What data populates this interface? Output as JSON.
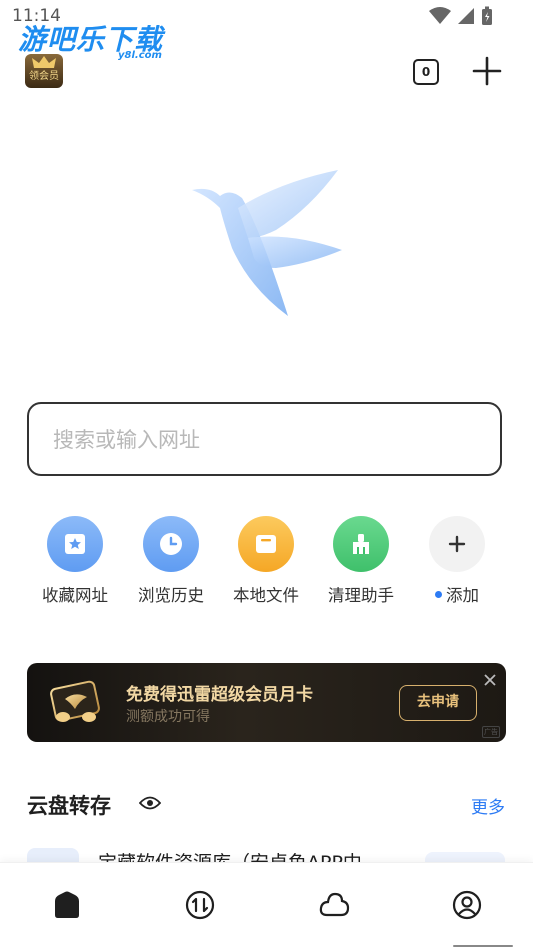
{
  "status_bar": {
    "time": "11:14"
  },
  "watermark": {
    "text": "游吧乐下载",
    "sub": "y8l.com"
  },
  "header": {
    "vip_badge_label": "领会员",
    "tab_count": "0"
  },
  "search": {
    "placeholder": "搜索或输入网址"
  },
  "shortcuts": [
    {
      "label": "收藏网址",
      "icon": "bookmark-star-icon",
      "color": "#6aa5f5"
    },
    {
      "label": "浏览历史",
      "icon": "clock-icon",
      "color": "#6aa5f5"
    },
    {
      "label": "本地文件",
      "icon": "folder-icon",
      "color": "#f9b63f"
    },
    {
      "label": "清理助手",
      "icon": "broom-icon",
      "color": "#4fcf7b"
    },
    {
      "label": "添加",
      "icon": "plus-icon",
      "color": "#f2f2f2"
    }
  ],
  "banner": {
    "title": "免费得迅雷超级会员月卡",
    "subtitle": "测额成功可得",
    "button": "去申请",
    "ad_mark": "广告"
  },
  "cloud_section": {
    "title": "云盘转存",
    "more": "更多",
    "first_item_text": "宝藏软件资源库（安卓鱼APP中"
  },
  "bottom_nav": [
    {
      "name": "home",
      "icon": "home-icon"
    },
    {
      "name": "transfer",
      "icon": "transfer-icon"
    },
    {
      "name": "cloud",
      "icon": "cloud-icon"
    },
    {
      "name": "profile",
      "icon": "profile-icon"
    }
  ],
  "colors": {
    "accent": "#2d7bf4",
    "banner_gold": "#f2d8a4",
    "border": "#333333"
  }
}
